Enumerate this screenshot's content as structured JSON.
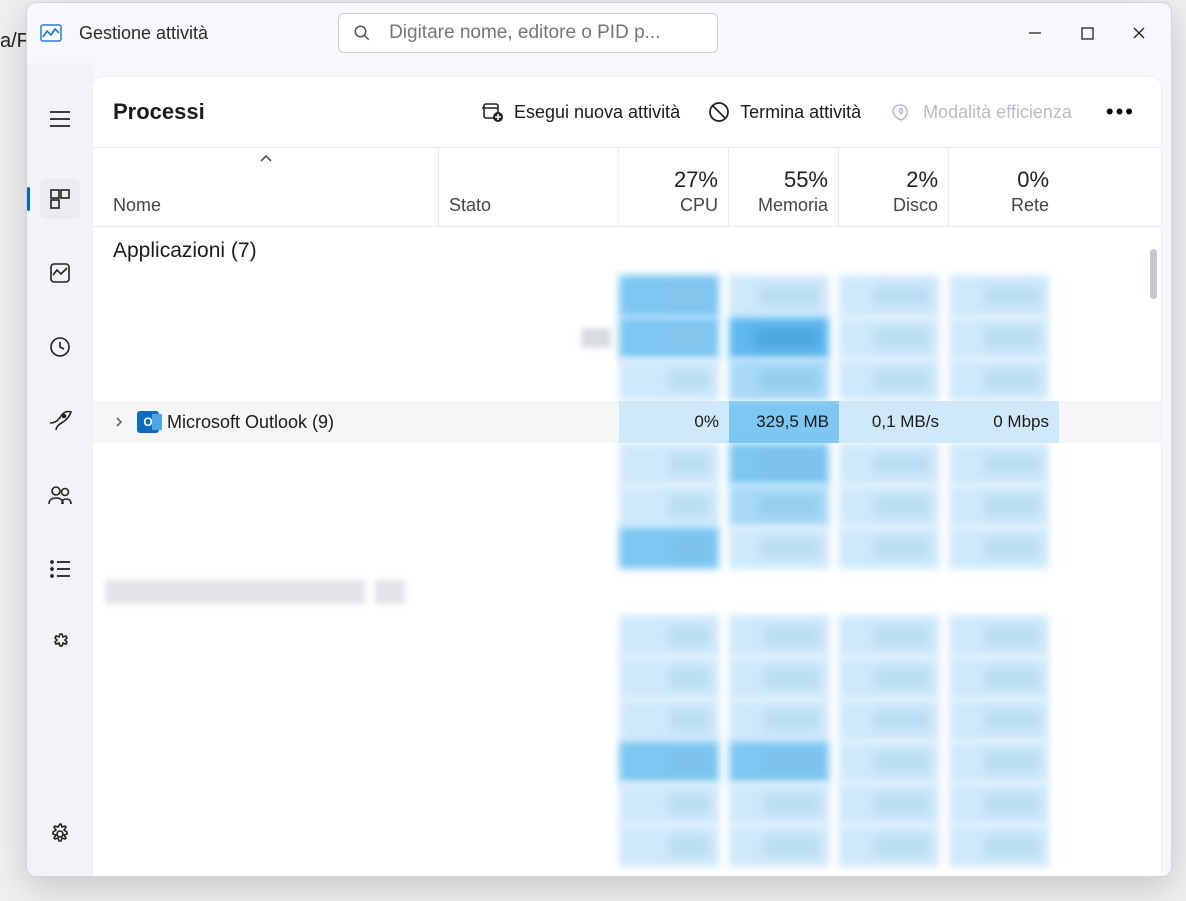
{
  "bg_fragment": "a/F",
  "title": "Gestione attività",
  "search": {
    "placeholder": "Digitare nome, editore o PID p..."
  },
  "panel": {
    "title": "Processi",
    "actions": {
      "new_task": "Esegui nuova attività",
      "end_task": "Termina attività",
      "efficiency": "Modalità efficienza"
    }
  },
  "headers": {
    "name": "Nome",
    "status": "Stato",
    "cpu_pct": "27%",
    "cpu": "CPU",
    "mem_pct": "55%",
    "mem": "Memoria",
    "disk_pct": "2%",
    "disk": "Disco",
    "net_pct": "0%",
    "net": "Rete"
  },
  "groups": {
    "apps": "Applicazioni (7)"
  },
  "outlook_row": {
    "name": "Microsoft Outlook (9)",
    "cpu": "0%",
    "mem": "329,5 MB",
    "disk": "0,1 MB/s",
    "net": "0 Mbps"
  }
}
